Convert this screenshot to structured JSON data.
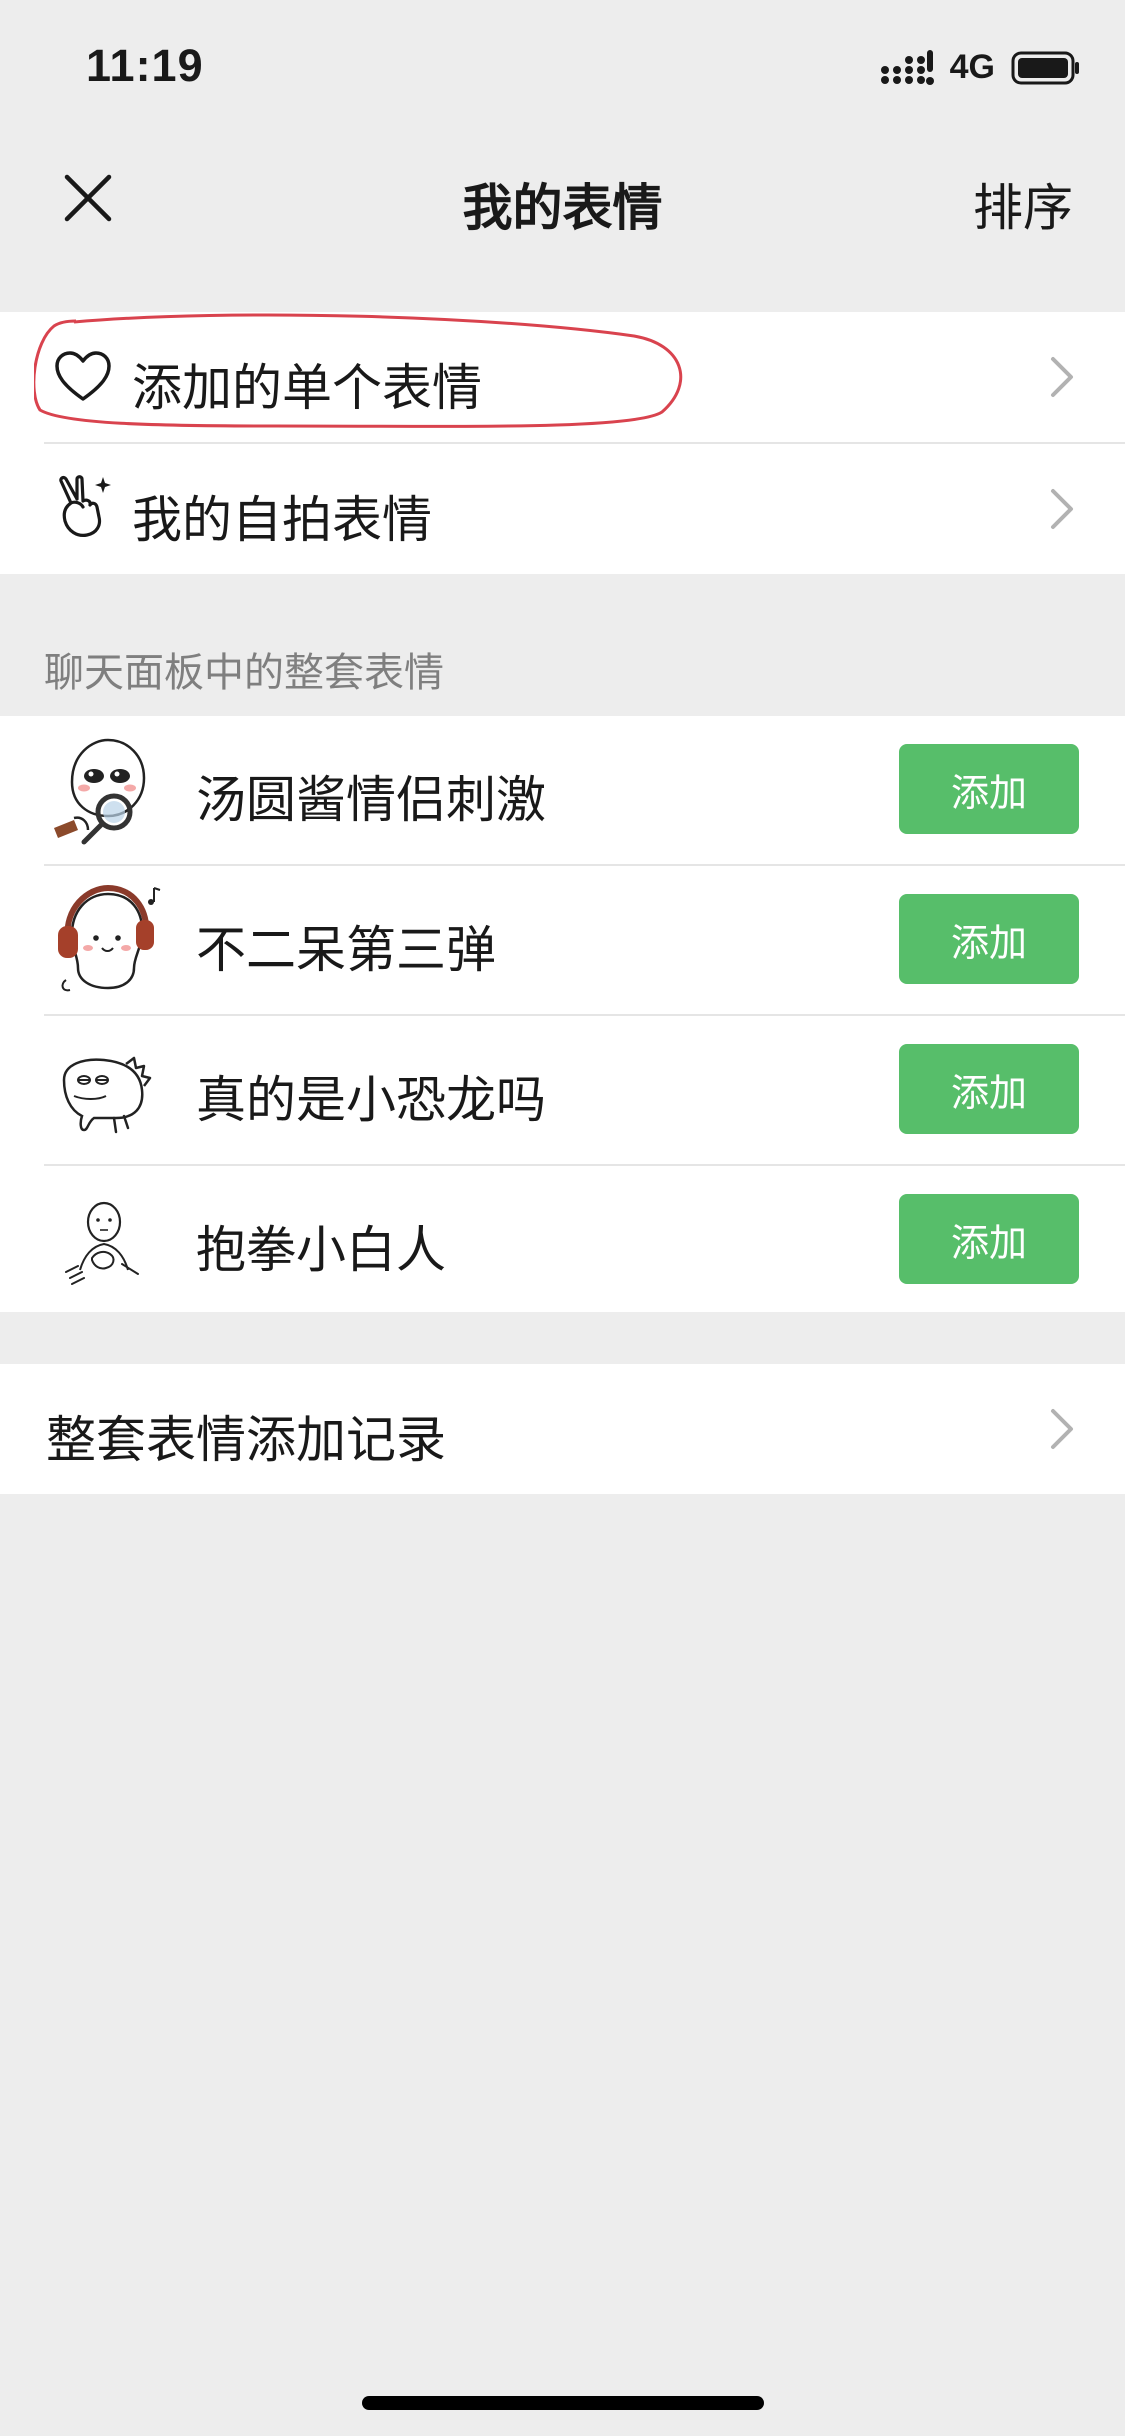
{
  "status_bar": {
    "time": "11:19",
    "network": "4G",
    "icons": [
      "signal-icon",
      "battery-icon"
    ]
  },
  "nav": {
    "title": "我的表情",
    "sort_label": "排序",
    "close_icon": "close-icon"
  },
  "top_group": {
    "items": [
      {
        "label": "添加的单个表情",
        "icon": "heart-icon",
        "annotated": true
      },
      {
        "label": "我的自拍表情",
        "icon": "victory-hand-icon"
      }
    ]
  },
  "sticker_section": {
    "header": "聊天面板中的整套表情",
    "add_label": "添加",
    "packs": [
      {
        "name": "汤圆酱情侣刺激",
        "sticker": "tangyuan-sticker-icon"
      },
      {
        "name": "不二呆第三弹",
        "sticker": "headphone-bun-sticker-icon"
      },
      {
        "name": "真的是小恐龙吗",
        "sticker": "little-dinosaur-sticker-icon"
      },
      {
        "name": "抱拳小白人",
        "sticker": "fist-salute-sticker-icon"
      }
    ]
  },
  "history": {
    "label": "整套表情添加记录"
  },
  "colors": {
    "background": "#ededed",
    "card": "#ffffff",
    "accent_green": "#57be6a",
    "annotation_red": "#d9434e",
    "secondary_text": "#7f7f7f"
  }
}
